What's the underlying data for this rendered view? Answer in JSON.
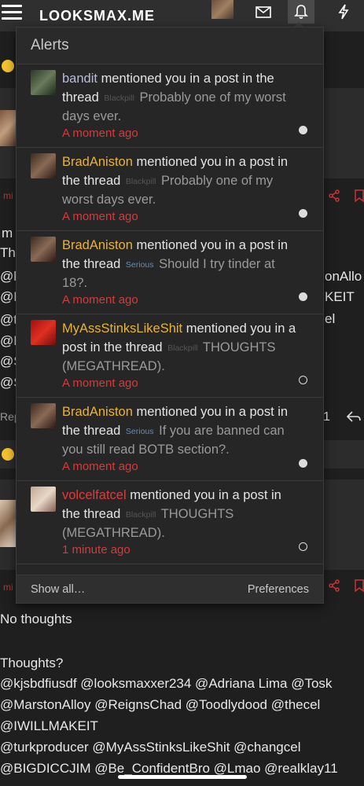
{
  "header": {
    "logo": "LOOKSMAX.ME"
  },
  "popup": {
    "title": "Alerts",
    "show_all": "Show all…",
    "preferences": "Preferences",
    "alerts": [
      {
        "user": "bandit",
        "action": "mentioned you in a post in the thread",
        "prefix": "Blackpill",
        "thread": "Probably one of my worst days ever.",
        "time": "A moment ago",
        "read": false
      },
      {
        "user": "BradAniston",
        "action": "mentioned you in a post in the thread",
        "prefix": "Blackpill",
        "thread": "Probably one of my worst days ever.",
        "time": "A moment ago",
        "read": false
      },
      {
        "user": "BradAniston",
        "action": "mentioned you in a post in the thread",
        "prefix": "Serious",
        "thread": "Should I try tinder at 18?.",
        "time": "A moment ago",
        "read": false
      },
      {
        "user": "MyAssStinksLikeShit",
        "action": "mentioned you in a post in the thread",
        "prefix": "Blackpill",
        "thread": "THOUGHTS (MEGATHREAD).",
        "time": "A moment ago",
        "read": true
      },
      {
        "user": "BradAniston",
        "action": "mentioned you in a post in the thread",
        "prefix": "Serious",
        "thread": "If you are banned can you still read BOTB section?.",
        "time": "A moment ago",
        "read": false
      },
      {
        "user": "volcelfatcel",
        "action": "mentioned you in a post in the thread",
        "prefix": "Blackpill",
        "thread": "THOUGHTS (MEGATHREAD).",
        "time": "1 minute ago",
        "read": true
      }
    ]
  },
  "background": {
    "left_fragments": [
      "m",
      "Tho",
      "@kj",
      "@R",
      "@tu",
      "@B",
      "@S",
      "@S",
      "Rep"
    ],
    "right_fragments": [
      "onAllo",
      "KEIT",
      "el",
      "1"
    ],
    "no_thoughts": "No thoughts",
    "thoughts_lines": [
      "Thoughts?",
      "@kjsbdfiusdf @looksmaxxer234 @Adriana Lima @Tosk",
      "@MarstonAlloy @ReignsChad @Toodlydood @thecel",
      "@IWILLMAKEIT",
      "@turkproducer @MyAssStinksLikeShit @changcel",
      "@BIGDICCJIM @Be_ConfidentBro @Lmao @realklay11"
    ]
  }
}
